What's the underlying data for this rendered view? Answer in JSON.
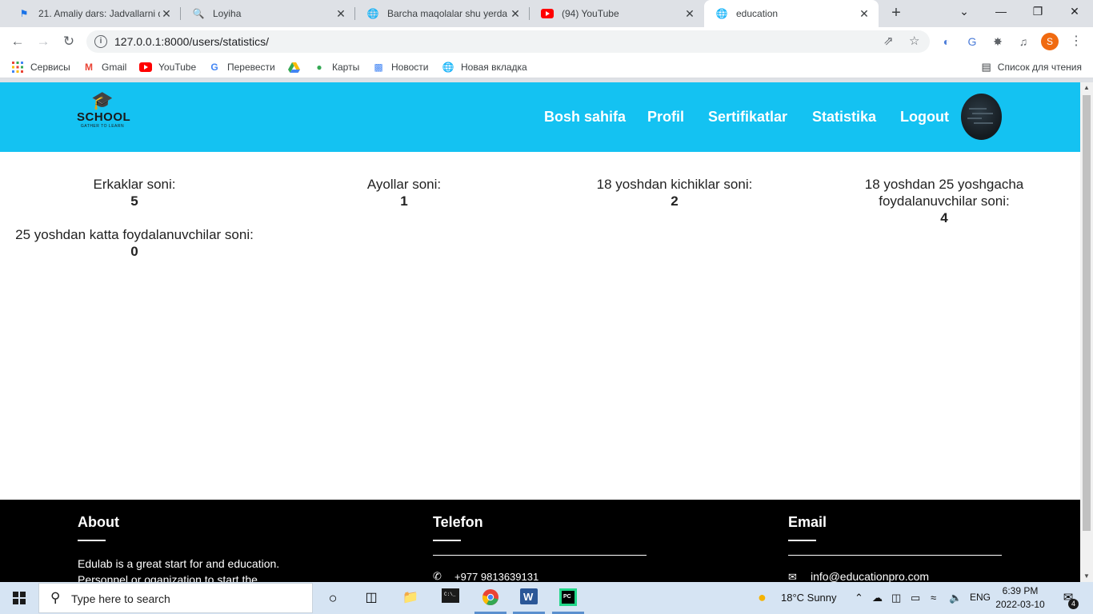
{
  "browser": {
    "tabs": [
      {
        "title": "21. Amaliy dars: Jadvallarni d",
        "icon": "bookmark-flag-icon",
        "active": false
      },
      {
        "title": "Loyiha",
        "icon": "magnifier-icon",
        "active": false
      },
      {
        "title": "Barcha maqolalar shu yerda",
        "icon": "globe-icon",
        "active": false
      },
      {
        "title": "(94) YouTube",
        "icon": "youtube-icon",
        "active": false
      },
      {
        "title": "education",
        "icon": "globe-icon",
        "active": true
      }
    ],
    "url": "127.0.0.1:8000/users/statistics/",
    "profile_initial": "S",
    "bookmarks": [
      {
        "label": "Сервисы",
        "icon": "apps-grid-icon"
      },
      {
        "label": "Gmail",
        "icon": "gmail-icon"
      },
      {
        "label": "YouTube",
        "icon": "youtube-icon"
      },
      {
        "label": "Перевести",
        "icon": "translate-icon"
      },
      {
        "label": "",
        "icon": "google-drive-icon"
      },
      {
        "label": "Карты",
        "icon": "maps-pin-icon"
      },
      {
        "label": "Новости",
        "icon": "news-icon"
      },
      {
        "label": "Новая вкладка",
        "icon": "globe-icon"
      }
    ],
    "reading_list": "Список для чтения",
    "accent_color": "#14c2f2"
  },
  "site": {
    "logo": {
      "name": "SCHOOL",
      "tagline": "GATHER TO LEARN"
    },
    "nav": [
      "Bosh sahifa",
      "Profil",
      "Sertifikatlar",
      "Statistika",
      "Logout"
    ],
    "stats": [
      {
        "label": "Erkaklar soni:",
        "value": "5"
      },
      {
        "label": "Ayollar soni:",
        "value": "1"
      },
      {
        "label": "18 yoshdan kichiklar soni:",
        "value": "2"
      },
      {
        "label": "18 yoshdan 25 yoshgacha foydalanuvchilar soni:",
        "value": "4"
      },
      {
        "label": "25 yoshdan katta foydalanuvchilar soni:",
        "value": "0"
      }
    ],
    "footer": {
      "about_title": "About",
      "about_text": "Edulab is a great start for and education. Personnel or oganization to start the",
      "phone_title": "Telefon",
      "phone": "+977 9813639131",
      "email_title": "Email",
      "email": "info@educationpro.com"
    }
  },
  "taskbar": {
    "search_placeholder": "Type here to search",
    "weather": "18°C  Sunny",
    "language": "ENG",
    "time": "6:39 PM",
    "date": "2022-03-10",
    "notification_count": "4"
  }
}
